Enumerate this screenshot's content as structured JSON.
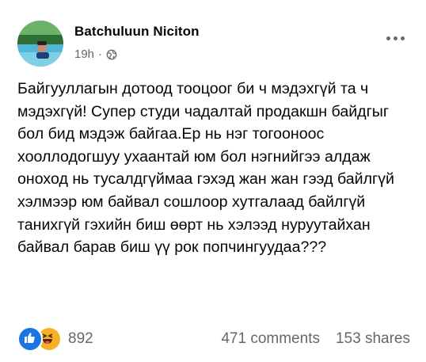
{
  "post": {
    "author": "Batchuluun Niciton",
    "time": "19h",
    "separator": "·",
    "privacy_icon": "globe-icon",
    "more_icon": "more-options-icon",
    "text": "Байгууллагын дотоод тооцоог би ч мэдэхгүй та ч мэдэхгүй! Супер студи чадалтай продакшн байдгыг бол бид мэдэж байгаа.Ер нь нэг тогооноос хооллодогшуу ухаантай юм бол нэгнийгээ алдаж оноход нь тусалдгүймаа гэхэд жан жан гээд байлгүй хэлмээр юм байвал сошлоор хутгалаад байлгүй танихгүй гэхийн биш өөрт нь хэлээд нуруутайхан байвал барав биш үү рок попчингуудаа???"
  },
  "footer": {
    "reaction_icons": [
      "like-icon",
      "haha-icon"
    ],
    "reaction_count": "892",
    "comments": "471 comments",
    "shares": "153 shares"
  },
  "colors": {
    "text": "#050505",
    "secondary": "#65676b",
    "like_blue": "#1b74e4",
    "haha_yellow": "#f7b125"
  }
}
